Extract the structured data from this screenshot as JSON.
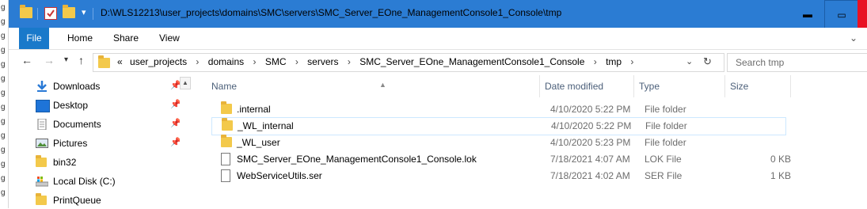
{
  "window": {
    "title": "D:\\WLS12213\\user_projects\\domains\\SMC\\servers\\SMC_Server_EOne_ManagementConsole1_Console\\tmp",
    "minimize_glyph": "▬",
    "maximize_glyph": "▭"
  },
  "ribbon": {
    "tabs": [
      "File",
      "Home",
      "Share",
      "View"
    ]
  },
  "address": {
    "overflow": "«",
    "crumbs": [
      "user_projects",
      "domains",
      "SMC",
      "servers",
      "SMC_Server_EOne_ManagementConsole1_Console",
      "tmp"
    ],
    "separator": "›"
  },
  "search": {
    "placeholder": "Search tmp"
  },
  "nav": {
    "items": [
      {
        "label": "Downloads",
        "icon": "downloads-icon",
        "pinned": true
      },
      {
        "label": "Desktop",
        "icon": "desktop-icon",
        "pinned": true
      },
      {
        "label": "Documents",
        "icon": "documents-icon",
        "pinned": true
      },
      {
        "label": "Pictures",
        "icon": "pictures-icon",
        "pinned": true
      },
      {
        "label": "bin32",
        "icon": "folder-icon",
        "pinned": false
      },
      {
        "label": "Local Disk (C:)",
        "icon": "local-disk-icon",
        "pinned": false
      },
      {
        "label": "PrintQueue",
        "icon": "folder-icon",
        "pinned": false
      }
    ]
  },
  "list": {
    "columns": [
      "Name",
      "Date modified",
      "Type",
      "Size"
    ],
    "rows": [
      {
        "name": ".internal",
        "date": "4/10/2020 5:22 PM",
        "type": "File folder",
        "size": "",
        "kind": "folder"
      },
      {
        "name": "_WL_internal",
        "date": "4/10/2020 5:22 PM",
        "type": "File folder",
        "size": "",
        "kind": "folder",
        "selected": true
      },
      {
        "name": "_WL_user",
        "date": "4/10/2020 5:23 PM",
        "type": "File folder",
        "size": "",
        "kind": "folder"
      },
      {
        "name": "SMC_Server_EOne_ManagementConsole1_Console.lok",
        "date": "7/18/2021 4:07 AM",
        "type": "LOK File",
        "size": "0 KB",
        "kind": "file"
      },
      {
        "name": "WebServiceUtils.ser",
        "date": "7/18/2021 4:02 AM",
        "type": "SER File",
        "size": "1 KB",
        "kind": "file"
      }
    ]
  },
  "colors": {
    "titlebar": "#2b7cd3",
    "file_tab": "#1979ca",
    "folder": "#f3c94b",
    "close": "#e81123",
    "selection_border": "#cde8ff"
  }
}
